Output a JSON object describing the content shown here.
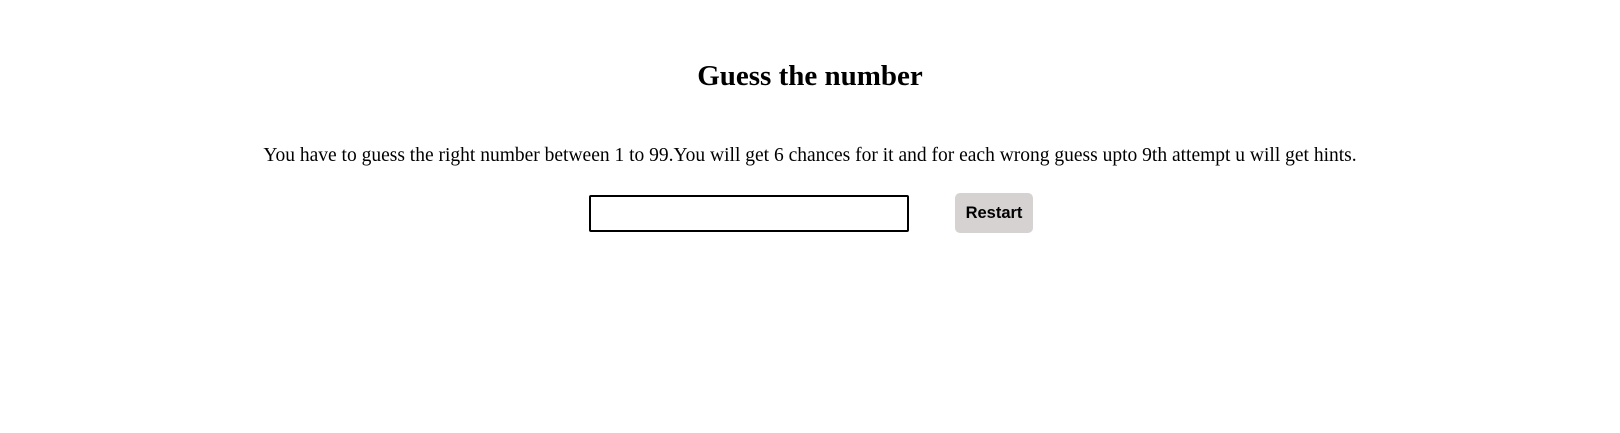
{
  "game": {
    "title": "Guess the number",
    "instructions": "You have to guess the right number between 1 to 99.You will get 6 chances for it and for each wrong guess upto 9th attempt u will get hints.",
    "guess_input": {
      "value": "",
      "placeholder": ""
    },
    "restart_label": "Restart"
  },
  "colors": {
    "background": "#ffffff",
    "text": "#000000",
    "button_background": "#d6d2d2",
    "input_border": "#000000"
  }
}
